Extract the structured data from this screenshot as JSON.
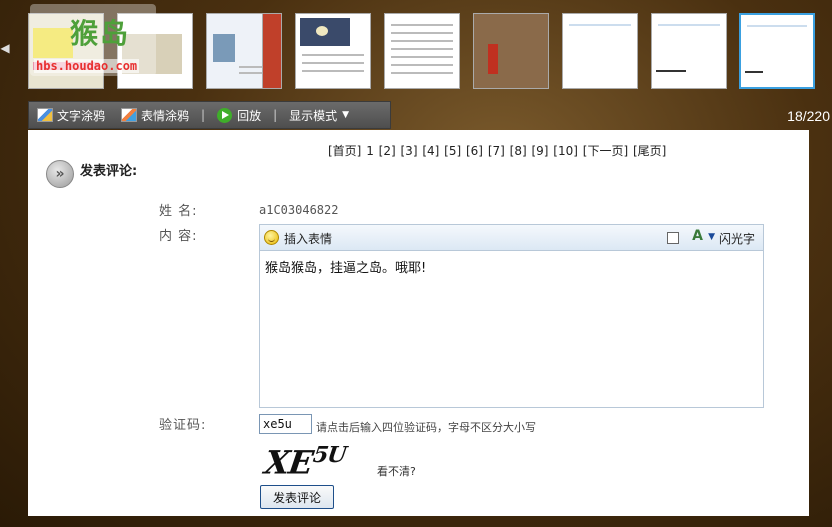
{
  "thumbnails": [
    {
      "name": "thumbnail-1"
    },
    {
      "name": "thumbnail-2"
    },
    {
      "name": "thumbnail-3"
    },
    {
      "name": "thumbnail-4"
    },
    {
      "name": "thumbnail-5"
    },
    {
      "name": "thumbnail-6"
    },
    {
      "name": "thumbnail-7"
    },
    {
      "name": "thumbnail-8"
    },
    {
      "name": "thumbnail-9"
    }
  ],
  "watermark": {
    "text": "猴岛",
    "url": "hbs.houdao.com"
  },
  "counter": "18/220",
  "toolbar": {
    "text_doodle": "文字涂鸦",
    "emoji_doodle": "表情涂鸦",
    "replay": "回放",
    "display_mode": "显示模式"
  },
  "pager": {
    "first": "[首页]",
    "current": "1",
    "pages": [
      "[2]",
      "[3]",
      "[4]",
      "[5]",
      "[6]",
      "[7]",
      "[8]",
      "[9]",
      "[10]"
    ],
    "next": "[下一页]",
    "last": "[尾页]"
  },
  "comment": {
    "section_title": "发表评论:",
    "name_label": "姓  名:",
    "username": "a1C03046822",
    "content_label": "内  容:",
    "insert_emoji": "插入表情",
    "flash_text": "闪光字",
    "content_value": "猴岛猴岛，挂逼之岛。哦耶!",
    "captcha_label": "验证码:",
    "captcha_value": "xe5u",
    "captcha_hint": "请点击后输入四位验证码，字母不区分大小写",
    "captcha_image_text": "XE",
    "captcha_image_sup": "5U",
    "cant_see": "看不清?",
    "submit": "发表评论"
  },
  "colors": {
    "active_thumb_border": "#3aa0e0",
    "toolbar_bg": "#5a5a5a",
    "submit_border": "#1e4f8a"
  }
}
